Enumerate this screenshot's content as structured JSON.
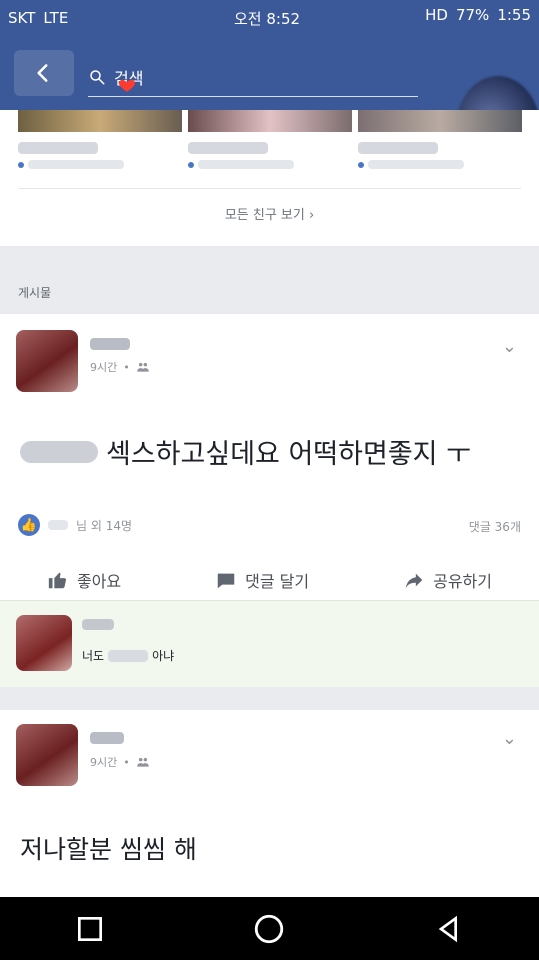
{
  "status": {
    "carrier": "SKT",
    "network": "LTE",
    "time": "오전 8:52",
    "hd": "HD",
    "battery": "77%",
    "clock": "1:55"
  },
  "search": {
    "placeholder": "검색"
  },
  "friends": {
    "see_all_label": "모든 친구 보기"
  },
  "section": {
    "title": "게시물"
  },
  "post1": {
    "time": "9시간",
    "text": "섹스하고싶데요 어떡하면좋지 ㅜ",
    "reaction_summary": "님 외 14명",
    "comment_count": "댓글 36개",
    "actions": {
      "like": "좋아요",
      "comment": "댓글 달기",
      "share": "공유하기"
    }
  },
  "comment1": {
    "text_prefix": "너도",
    "text_suffix": "아냐"
  },
  "post2": {
    "time": "9시간",
    "text": "저나할분 씸씸 해"
  },
  "icons": {
    "heart": "heart-icon",
    "search": "search-icon",
    "back": "back-icon",
    "like": "like-icon",
    "comment": "comment-icon",
    "share": "share-icon",
    "chevron": "chevron-down-icon",
    "friends": "friends-icon",
    "square": "recent-apps-icon",
    "circle": "home-icon",
    "triangle": "back-nav-icon"
  },
  "colors": {
    "facebook_blue": "#3b5998",
    "page_bg": "#e9ebee",
    "comment_bg": "#f3f8ef"
  }
}
